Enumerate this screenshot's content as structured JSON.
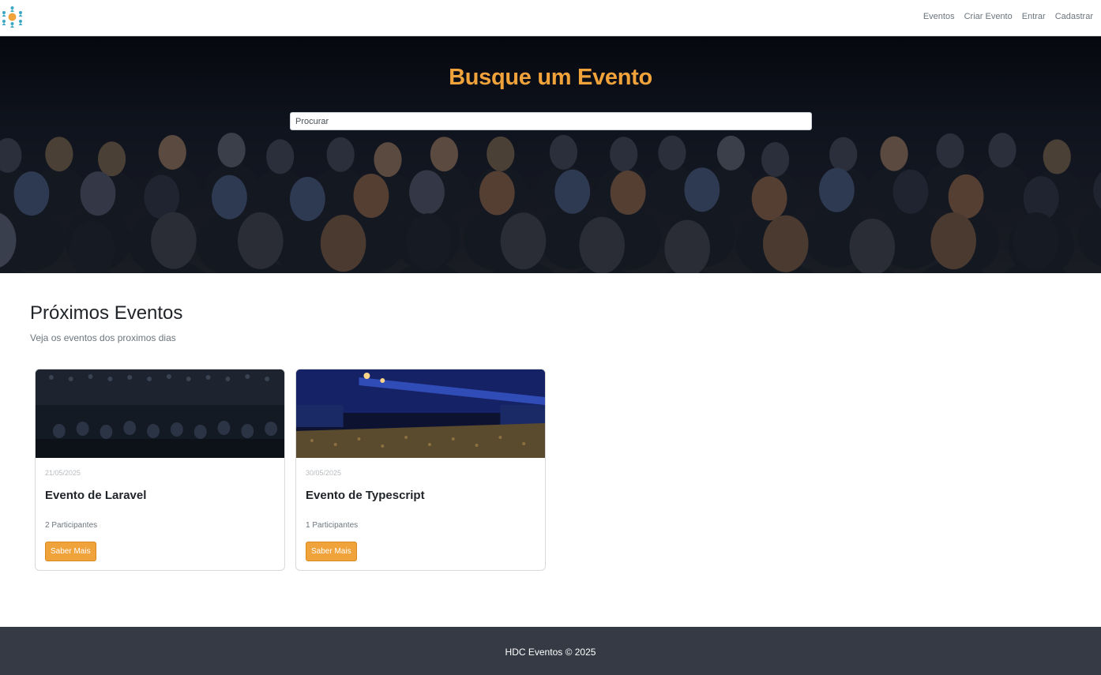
{
  "nav": {
    "logo_icon": "event-people-icon",
    "links": [
      "Eventos",
      "Criar Evento",
      "Entrar",
      "Cadastrar"
    ]
  },
  "hero": {
    "title": "Busque um Evento",
    "search_placeholder": "Procurar"
  },
  "section": {
    "title": "Próximos Eventos",
    "subtitle": "Veja os eventos dos proximos dias"
  },
  "events": [
    {
      "date": "21/05/2025",
      "title": "Evento de Laravel",
      "participants": "2 Participantes",
      "button": "Saber Mais"
    },
    {
      "date": "30/05/2025",
      "title": "Evento de Typescript",
      "participants": "1 Participantes",
      "button": "Saber Mais"
    }
  ],
  "footer": {
    "text": "HDC Eventos © 2025"
  },
  "colors": {
    "accent": "#f0a23b",
    "footer_bg": "#353a44",
    "logo_blue": "#3aa7c4"
  }
}
